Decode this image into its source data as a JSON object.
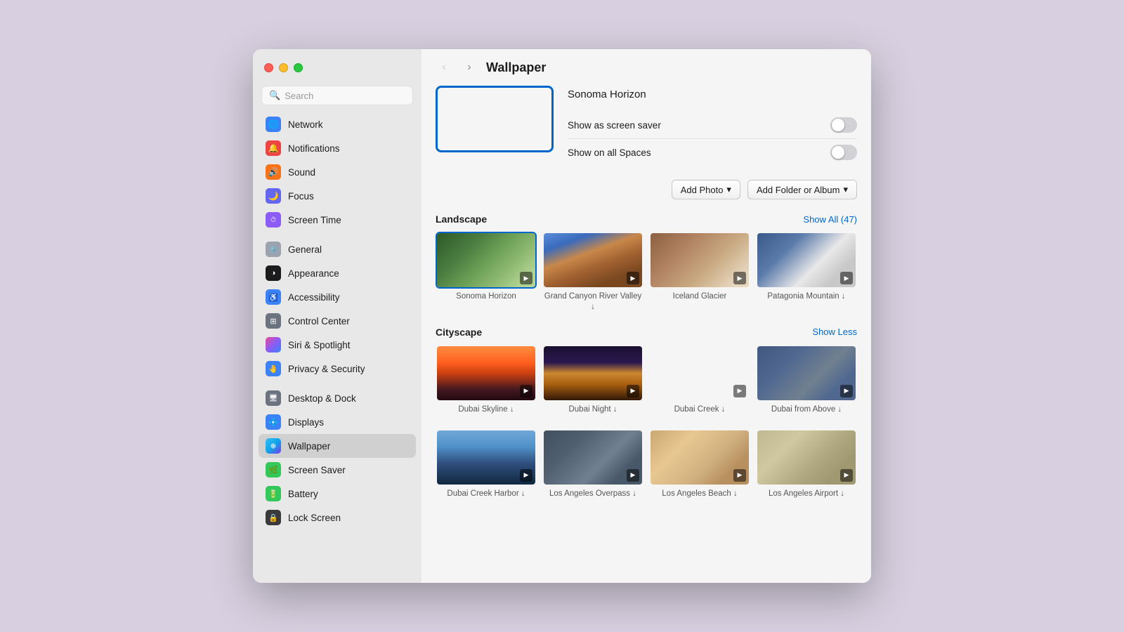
{
  "window": {
    "title": "Wallpaper"
  },
  "sidebar": {
    "search_placeholder": "Search",
    "items": [
      {
        "id": "network",
        "label": "Network",
        "icon_color": "#3b82f6",
        "icon": "🌐"
      },
      {
        "id": "notifications",
        "label": "Notifications",
        "icon_color": "#ef4444",
        "icon": "🔔"
      },
      {
        "id": "sound",
        "label": "Sound",
        "icon_color": "#f97316",
        "icon": "🔊"
      },
      {
        "id": "focus",
        "label": "Focus",
        "icon_color": "#8b5cf6",
        "icon": "🌙"
      },
      {
        "id": "screen-time",
        "label": "Screen Time",
        "icon_color": "#8b5cf6",
        "icon": "⏱"
      },
      {
        "id": "general",
        "label": "General",
        "icon_color": "#6b7280",
        "icon": "⚙️"
      },
      {
        "id": "appearance",
        "label": "Appearance",
        "icon_color": "#1c1c1e",
        "icon": "🎨"
      },
      {
        "id": "accessibility",
        "label": "Accessibility",
        "icon_color": "#3b82f6",
        "icon": "♿"
      },
      {
        "id": "control-center",
        "label": "Control Center",
        "icon_color": "#6b7280",
        "icon": "⊞"
      },
      {
        "id": "siri-spotlight",
        "label": "Siri & Spotlight",
        "icon_color": "#ec4899",
        "icon": "✨"
      },
      {
        "id": "privacy-security",
        "label": "Privacy & Security",
        "icon_color": "#3b82f6",
        "icon": "🤚"
      },
      {
        "id": "desktop-dock",
        "label": "Desktop & Dock",
        "icon_color": "#6b7280",
        "icon": "🖥"
      },
      {
        "id": "displays",
        "label": "Displays",
        "icon_color": "#3b82f6",
        "icon": "💠"
      },
      {
        "id": "wallpaper",
        "label": "Wallpaper",
        "icon_color": "#3b9fe8",
        "icon": "🖼",
        "active": true
      },
      {
        "id": "screen-saver",
        "label": "Screen Saver",
        "icon_color": "#34c759",
        "icon": "🌿"
      },
      {
        "id": "battery",
        "label": "Battery",
        "icon_color": "#34c759",
        "icon": "🔋"
      },
      {
        "id": "lock-screen",
        "label": "Lock Screen",
        "icon_color": "#1c1c1e",
        "icon": "🔒"
      }
    ]
  },
  "header": {
    "back_label": "‹",
    "forward_label": "›",
    "title": "Wallpaper"
  },
  "current_wallpaper": {
    "name": "Sonoma Horizon",
    "show_screensaver_label": "Show as screen saver",
    "show_spaces_label": "Show on all Spaces",
    "show_screensaver_on": false,
    "show_spaces_on": false
  },
  "buttons": {
    "add_photo": "Add Photo",
    "add_folder": "Add Folder or Album"
  },
  "landscape_section": {
    "title": "Landscape",
    "show_all_label": "Show All (47)",
    "items": [
      {
        "name": "Sonoma Horizon",
        "selected": true,
        "img_class": "img-sonoma",
        "download": false
      },
      {
        "name": "Grand Canyon River Valley ↓",
        "selected": false,
        "img_class": "img-grand-canyon",
        "download": true
      },
      {
        "name": "Iceland Glacier",
        "selected": false,
        "img_class": "img-iceland",
        "download": false
      },
      {
        "name": "Patagonia Mountain ↓",
        "selected": false,
        "img_class": "img-patagonia",
        "download": true
      }
    ]
  },
  "cityscape_section": {
    "title": "Cityscape",
    "show_less_label": "Show Less",
    "rows": [
      [
        {
          "name": "Dubai Skyline ↓",
          "img_class": "img-dubai-skyline"
        },
        {
          "name": "Dubai Night ↓",
          "img_class": "img-dubai-night"
        },
        {
          "name": "Dubai Creek ↓",
          "img_class": "img-dubai-creek"
        },
        {
          "name": "Dubai from Above ↓",
          "img_class": "img-dubai-above"
        }
      ],
      [
        {
          "name": "Dubai Creek Harbor ↓",
          "img_class": "img-dubai-creek-harbor"
        },
        {
          "name": "Los Angeles Overpass ↓",
          "img_class": "img-la-overpass"
        },
        {
          "name": "Los Angeles Beach ↓",
          "img_class": "img-la-beach"
        },
        {
          "name": "Los Angeles Airport ↓",
          "img_class": "img-la-airport"
        }
      ]
    ]
  }
}
